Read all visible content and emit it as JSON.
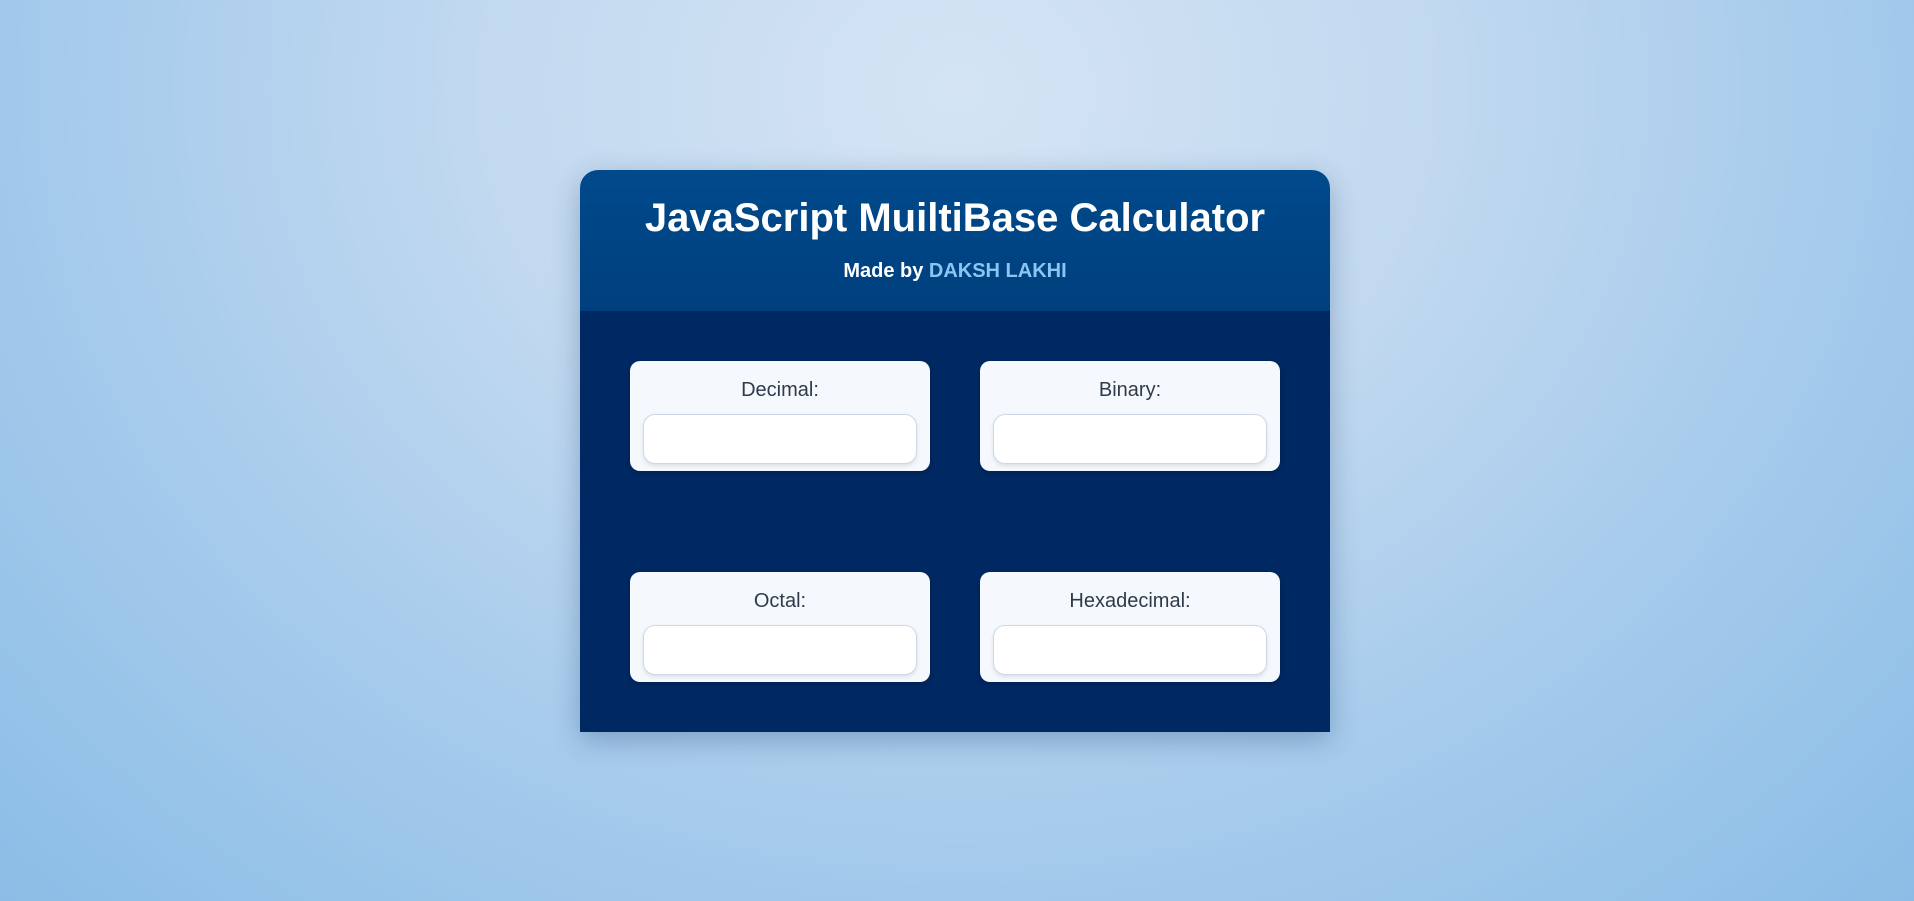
{
  "header": {
    "title": "JavaScript MuiltiBase Calculator",
    "made_by_prefix": "Made by ",
    "author": "DAKSH LAKHI"
  },
  "fields": {
    "decimal": {
      "label": "Decimal:",
      "value": ""
    },
    "binary": {
      "label": "Binary:",
      "value": ""
    },
    "octal": {
      "label": "Octal:",
      "value": ""
    },
    "hexadecimal": {
      "label": "Hexadecimal:",
      "value": ""
    }
  },
  "colors": {
    "header_bg": "#004a8c",
    "body_bg": "#002862",
    "author_link": "#8cc4f2"
  }
}
